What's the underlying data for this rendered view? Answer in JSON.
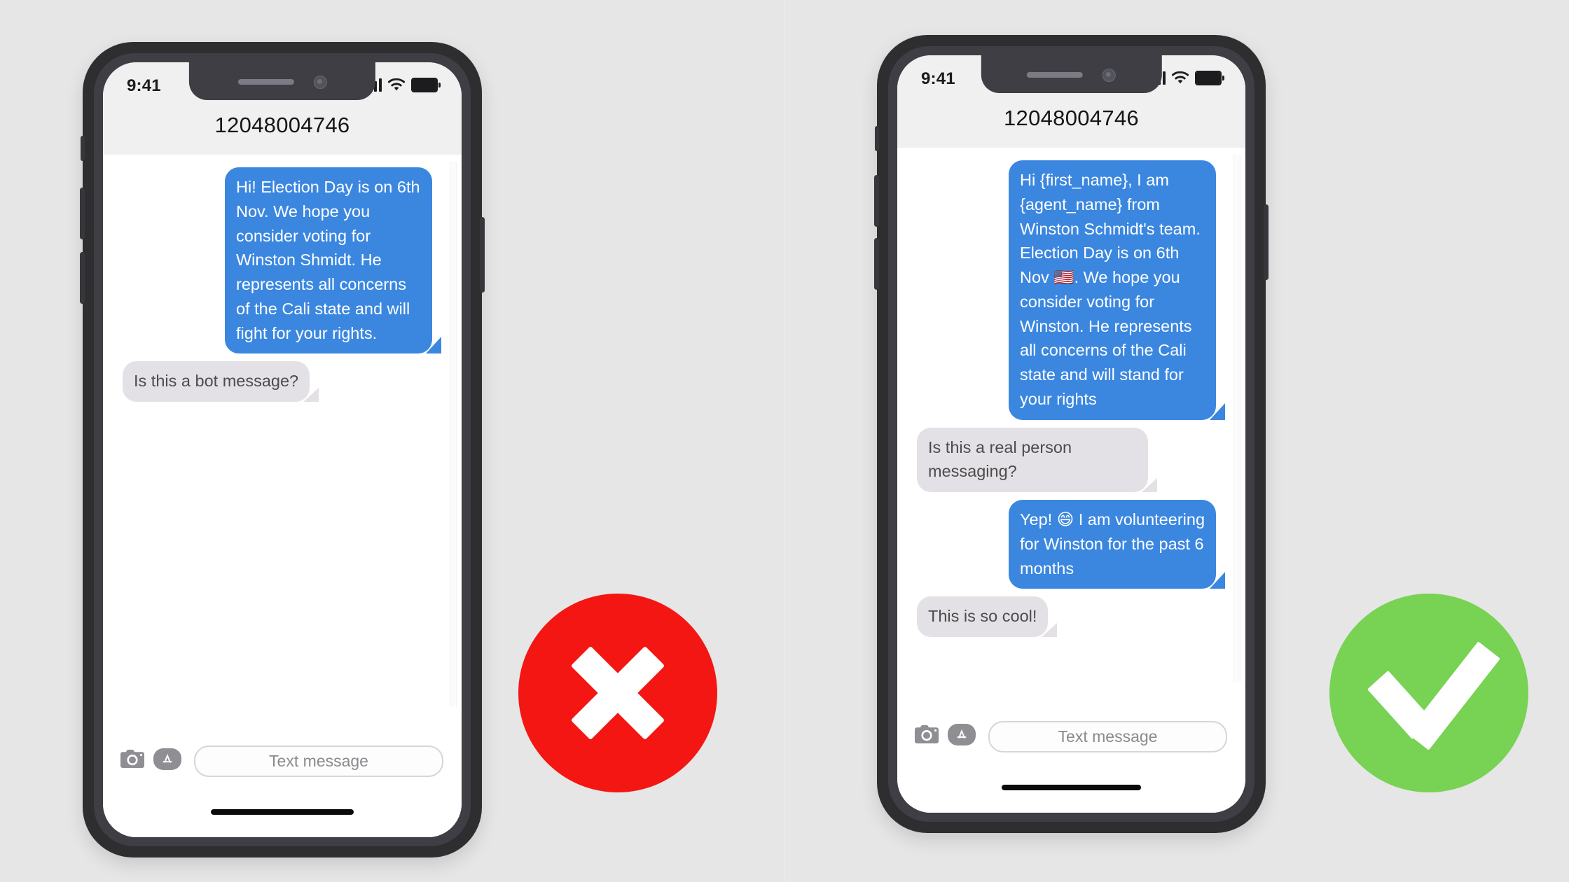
{
  "page": {
    "background_color": "#e6e6e6",
    "divider_color": "#efefef"
  },
  "colors": {
    "bubble_outgoing": "#3b87e0",
    "bubble_incoming": "#e4e1e6",
    "bad_badge": "#f41612",
    "good_badge": "#78d253",
    "phone_frame": "#2e2e31",
    "status_bar": "#f0f0f0"
  },
  "panels": [
    {
      "id": "bad-example",
      "verdict": {
        "type": "cross",
        "icon_name": "red-cross-icon",
        "color": "#f41612"
      },
      "phone": {
        "status_bar": {
          "time": "9:41",
          "signal_icon": "cellular-signal-icon",
          "wifi_icon": "wifi-icon",
          "battery_icon": "battery-full-icon"
        },
        "conversation_title": "12048004746",
        "messages": [
          {
            "direction": "outgoing",
            "text": "Hi! Election Day is on 6th Nov. We hope you consider voting for Winston Shmidt. He represents all concerns of the Cali state and will fight for your rights."
          },
          {
            "direction": "incoming",
            "text": "Is this a bot message?"
          }
        ],
        "input_bar": {
          "camera_icon": "camera-icon",
          "appstore_icon": "app-store-icon",
          "placeholder": "Text message"
        }
      }
    },
    {
      "id": "good-example",
      "verdict": {
        "type": "check",
        "icon_name": "green-check-icon",
        "color": "#78d253"
      },
      "phone": {
        "status_bar": {
          "time": "9:41",
          "signal_icon": "cellular-signal-icon",
          "wifi_icon": "wifi-icon",
          "battery_icon": "battery-full-icon"
        },
        "conversation_title": "12048004746",
        "messages": [
          {
            "direction": "outgoing",
            "text": "Hi {first_name}, I am {agent_name} from Winston Schmidt's team. Election Day is on 6th Nov 🇺🇸. We hope you consider voting for Winston. He represents all concerns of the Cali state and will stand for your rights"
          },
          {
            "direction": "incoming",
            "text": "Is this a real person messaging?"
          },
          {
            "direction": "outgoing",
            "text": "Yep! 😄 I am volunteering for Winston for the past 6 months"
          },
          {
            "direction": "incoming",
            "text": "This is so cool!"
          }
        ],
        "input_bar": {
          "camera_icon": "camera-icon",
          "appstore_icon": "app-store-icon",
          "placeholder": "Text message"
        }
      }
    }
  ]
}
